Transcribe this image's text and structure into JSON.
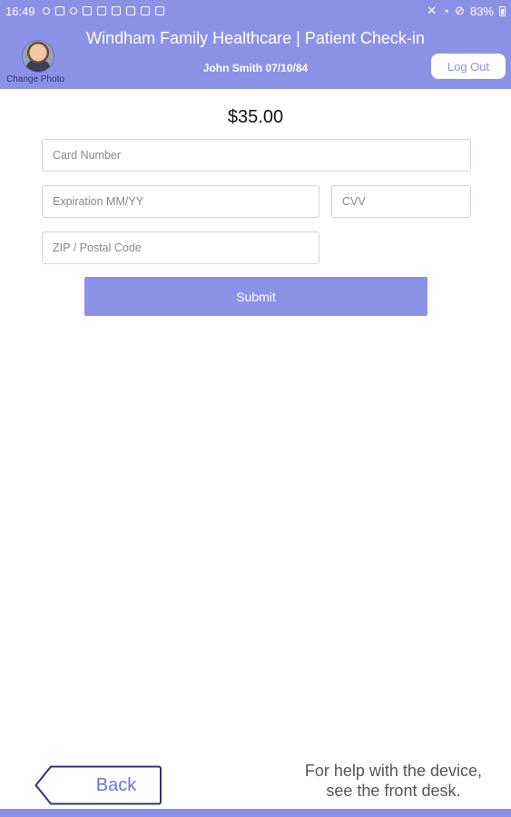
{
  "status_bar": {
    "time": "16:49",
    "battery": "83%",
    "notification_icons": [
      "location-icon",
      "upload-icon",
      "settings-icon",
      "calendar-icon",
      "image-icon",
      "tag-icon",
      "app-icon",
      "calendar-icon",
      "play-icon"
    ],
    "status_icons": [
      "mute-icon",
      "wifi-icon",
      "do-not-disturb-icon",
      "battery-icon"
    ]
  },
  "header": {
    "title": "Windham Family Healthcare | Patient Check-in",
    "patient": "John Smith 07/10/84",
    "change_photo": "Change Photo",
    "logout": "Log Out"
  },
  "payment": {
    "amount": "$35.00",
    "card_number_placeholder": "Card Number",
    "expiration_placeholder": "Expiration MM/YY",
    "cvv_placeholder": "CVV",
    "zip_placeholder": "ZIP / Postal Code",
    "submit": "Submit"
  },
  "footer": {
    "back": "Back",
    "help_line1": "For help with the device,",
    "help_line2": "see the front desk."
  },
  "colors": {
    "accent": "#8b92e6",
    "back_text": "#6b73d8"
  }
}
